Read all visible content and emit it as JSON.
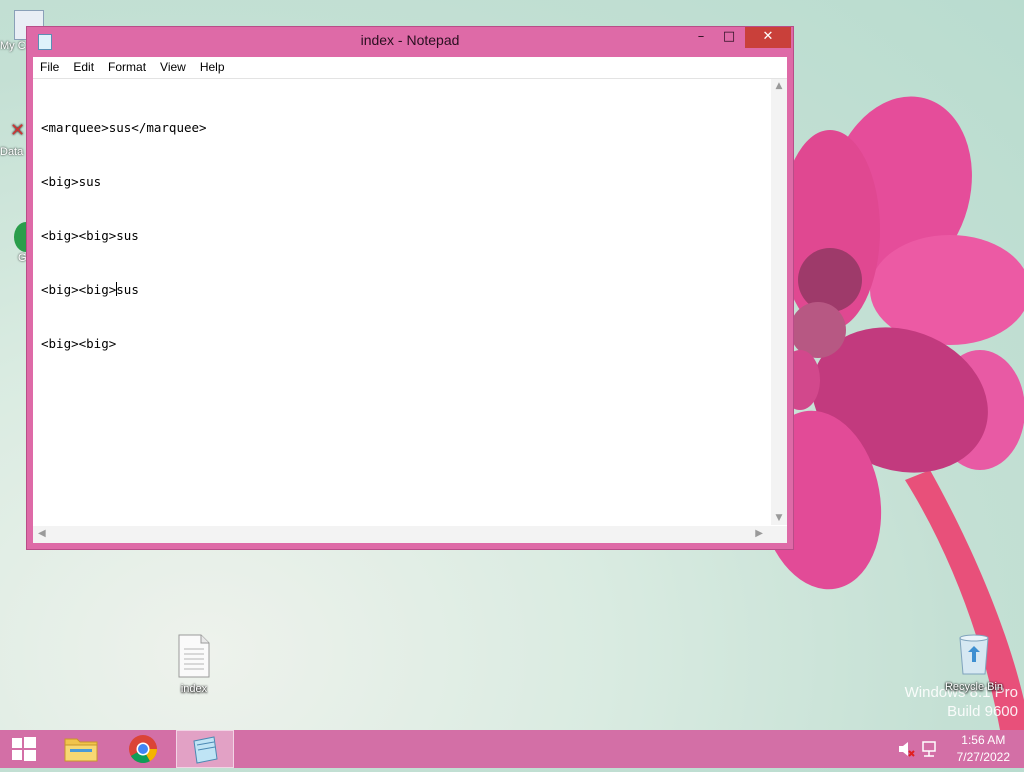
{
  "desktop": {
    "icons": {
      "my_computer": "My C",
      "data": "Data",
      "chrome_letters": "G",
      "index_file": "index",
      "recycle_bin": "Recycle Bin"
    },
    "watermark": {
      "line1": "Windows 8.1 Pro",
      "line2": "Build 9600"
    }
  },
  "window": {
    "title": "index - Notepad",
    "controls": {
      "minimize": "–",
      "maximize": "□",
      "close": "✕"
    },
    "menu": [
      "File",
      "Edit",
      "Format",
      "View",
      "Help"
    ],
    "text_lines": [
      "<marquee>sus</marquee>",
      "<big>sus",
      "<big><big>sus",
      "<big><big>sus",
      "<big><big>"
    ],
    "caret": {
      "line": 4,
      "column": 10
    }
  },
  "taskbar": {
    "buttons": [
      "start-button",
      "file-explorer",
      "google-chrome",
      "notepad"
    ],
    "clock": {
      "time": "1:56 AM",
      "date": "7/27/2022"
    },
    "tray_icons": [
      "speaker-muted-icon",
      "network-icon"
    ]
  },
  "colors": {
    "window_frame": "#de6aa7",
    "taskbar": "#d36fa6",
    "close_button": "#c9403a"
  }
}
